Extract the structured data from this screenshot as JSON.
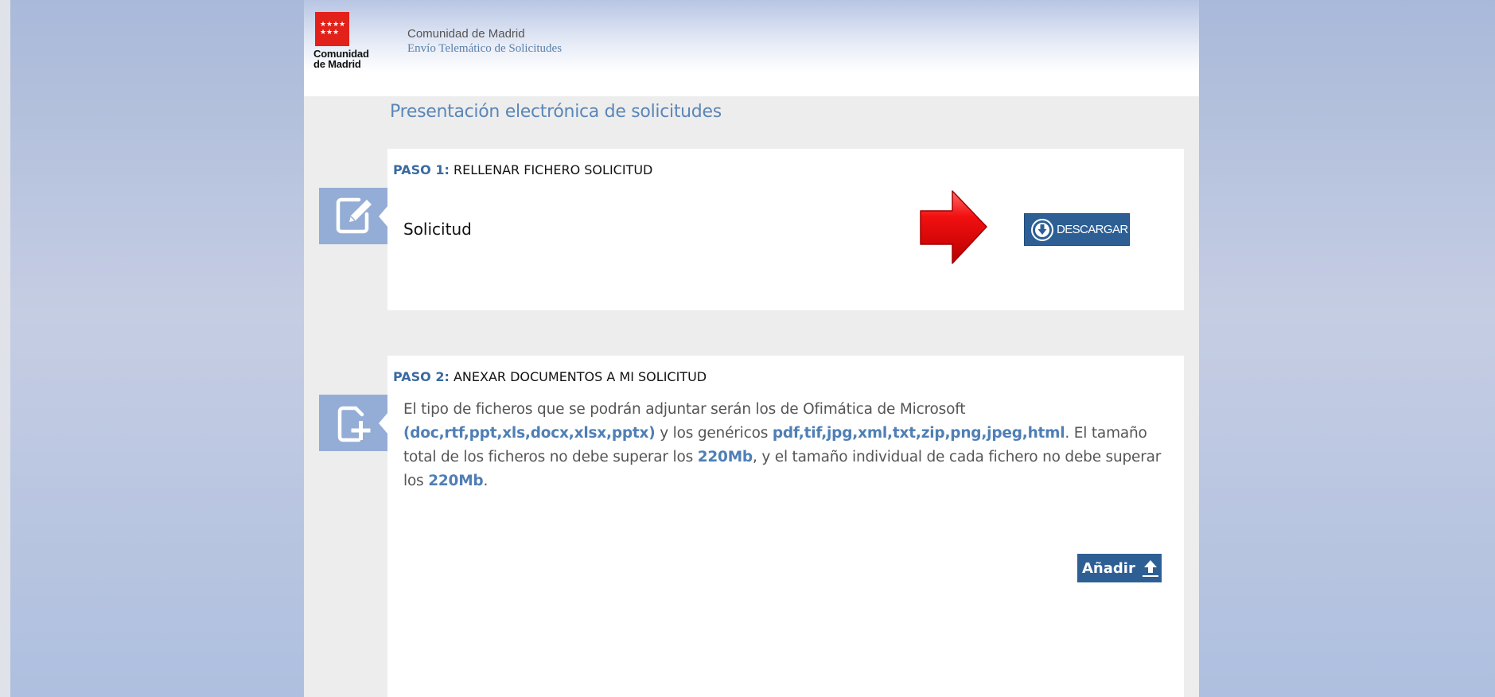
{
  "header": {
    "logo_line1": "Comunidad",
    "logo_line2": "de Madrid",
    "title_line1": "Comunidad de Madrid",
    "title_line2": "Envío Telemático de Solicitudes"
  },
  "page_title": "Presentación electrónica de solicitudes",
  "step1": {
    "num": "PASO 1:",
    "title": " RELLENAR FICHERO SOLICITUD",
    "item_label": "Solicitud",
    "download_label": "DESCARGAR",
    "icon": "edit-document-icon"
  },
  "step2": {
    "num": "PASO 2:",
    "title": " ANEXAR DOCUMENTOS A MI SOLICITUD",
    "icon": "add-document-icon",
    "text": {
      "p1": "El tipo de ficheros que se podrán adjuntar serán los de Ofimática de Microsoft ",
      "formats_ms": "(doc,rtf,ppt,xls,docx,xlsx,pptx)",
      "p2": " y los genéricos ",
      "formats_generic": "pdf,tif,jpg,xml,txt,zip,png,jpeg,html",
      "p3": ". El tamaño total de los ficheros no debe superar los ",
      "max_total": "220Mb",
      "p4": ", y el tamaño individual de cada fichero no debe superar los ",
      "max_individual": "220Mb",
      "p5": "."
    },
    "add_label": "Añadir"
  },
  "colors": {
    "brand_red": "#e3211b",
    "accent_blue": "#2d5f95",
    "highlight_blue": "#4f7fb5",
    "icon_block": "#94add6"
  }
}
